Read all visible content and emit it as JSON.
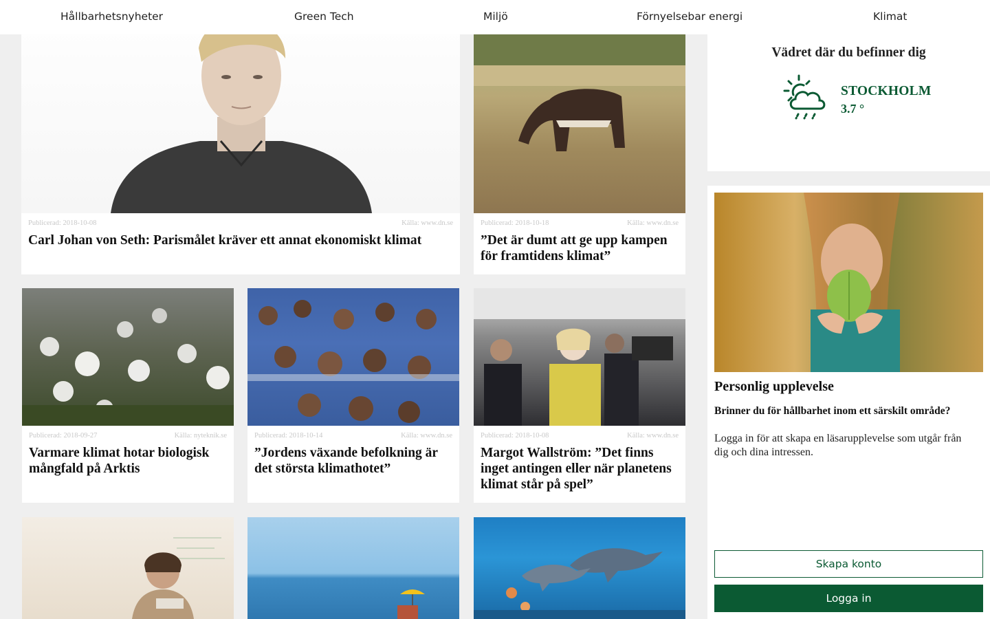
{
  "nav": {
    "items": [
      "Hållbarhetsnyheter",
      "Green Tech",
      "Miljö",
      "Förnyelsebar energi",
      "Klimat"
    ]
  },
  "articles": [
    {
      "date": "Publicerad: 2018-10-08",
      "source": "Källa: www.dn.se",
      "title": "Carl Johan von Seth: Parismålet kräver ett annat ekonomiskt klimat"
    },
    {
      "date": "Publicerad: 2018-10-18",
      "source": "Källa: www.dn.se",
      "title": "”Det är dumt att ge upp kampen för framtidens klimat”"
    },
    {
      "date": "Publicerad: 2018-09-27",
      "source": "Källa: nyteknik.se",
      "title": "Varmare klimat hotar biologisk mångfald på Arktis"
    },
    {
      "date": "Publicerad: 2018-10-14",
      "source": "Källa: www.dn.se",
      "title": "”Jordens växande befolkning är det största klimathotet”"
    },
    {
      "date": "Publicerad: 2018-10-08",
      "source": "Källa: www.dn.se",
      "title": "Margot Wallström: ”Det finns inget antingen eller när planetens klimat står på spel”"
    }
  ],
  "weather": {
    "title": "Vädret där du befinner dig",
    "city": "STOCKHOLM",
    "temp": "3.7 °",
    "icon": "cloud-sun-rain-icon"
  },
  "personal": {
    "title": "Personlig upplevelse",
    "subtitle": "Brinner du för hållbarhet inom ett särskilt område?",
    "text": "Logga in för att skapa en läsarupplevelse som utgår från dig och dina intressen.",
    "create_account": "Skapa konto",
    "login": "Logga in"
  },
  "colors": {
    "brand": "#0b5a33",
    "background": "#efefef"
  }
}
